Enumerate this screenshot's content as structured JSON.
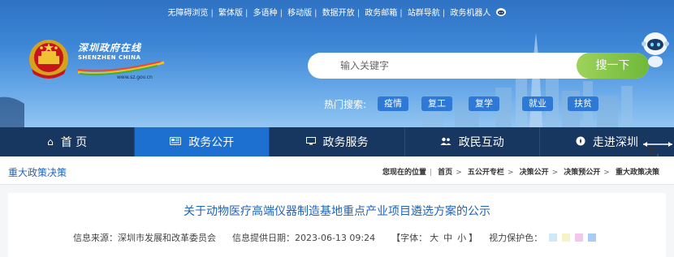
{
  "topbar": {
    "links": [
      "无障碍浏览",
      "繁体版",
      "多语种",
      "移动版",
      "数据开放",
      "政务邮箱",
      "站群导航",
      "政务机器人"
    ]
  },
  "brand": {
    "cn_name": "深圳政府在线",
    "en_name": "SHENZHEN CHINA",
    "url": "www.sz.gov.cn"
  },
  "search": {
    "placeholder": "输入关键字",
    "button_label": "搜一下"
  },
  "hot_search": {
    "label": "热门搜索:",
    "tags": [
      "疫情",
      "复工",
      "复学",
      "就业",
      "扶贫"
    ]
  },
  "nav": {
    "items": [
      {
        "label": "首 页",
        "icon": "home-icon"
      },
      {
        "label": "政务公开",
        "icon": "news-icon"
      },
      {
        "label": "政务服务",
        "icon": "monitor-icon"
      },
      {
        "label": "政民互动",
        "icon": "people-icon"
      },
      {
        "label": "走进深圳",
        "icon": "compass-icon"
      }
    ],
    "active_index": 1
  },
  "side_control": {
    "count": "0"
  },
  "section": {
    "title": "重大政策决策"
  },
  "breadcrumb": {
    "prefix": "您现在的位置",
    "items": [
      "首页",
      "五公开专栏",
      "决策公开",
      "决策预公开",
      "重大政策决策"
    ]
  },
  "article": {
    "title": "关于动物医疗高端仪器制造基地重点产业项目遴选方案的公示",
    "source_label": "信息来源：",
    "source": "深圳市发展和改革委员会",
    "date_label": "信息提供日期：",
    "date": "2023-06-13 09:24",
    "font_label": "【字体：",
    "font_sizes": [
      "大",
      "中",
      "小"
    ],
    "font_close": "】",
    "vision_label": "视力保护色：",
    "vision_colors": [
      "#cfe9f7",
      "#f6f3c8",
      "#f3c6ee",
      "#a9cdf2"
    ]
  },
  "colors": {
    "nav_bg": "#173660",
    "nav_active": "#1d6fd0",
    "link_blue": "#1f63b8",
    "search_button": "#8cc84b"
  }
}
